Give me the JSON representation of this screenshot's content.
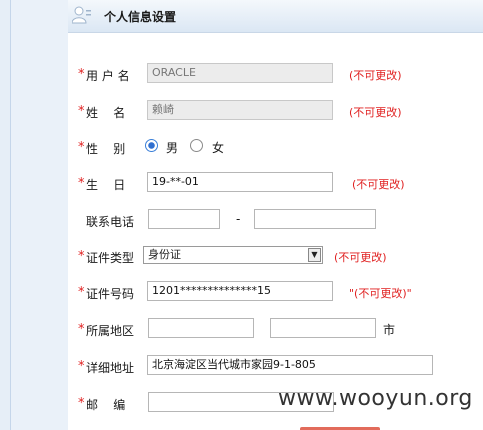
{
  "header": {
    "title": "个人信息设置",
    "icon": "user-icon"
  },
  "form": {
    "username": {
      "star": "*",
      "label": "用 户 名",
      "value": "ORACLE",
      "note": "(不可更改)"
    },
    "name": {
      "star": "*",
      "label": "姓    名",
      "value": "赖崎",
      "note": "(不可更改)"
    },
    "gender": {
      "star": "*",
      "label": "性    别",
      "options": [
        "男",
        "女"
      ],
      "selected": "男"
    },
    "birthday": {
      "star": "*",
      "label": "生    日",
      "value": "19-**-01",
      "note": "(不可更改)"
    },
    "phone": {
      "label": "联系电话",
      "separator": "-",
      "area_value": "",
      "number_value": ""
    },
    "id_type": {
      "star": "*",
      "label": "证件类型",
      "value": "身份证",
      "note": "(不可更改)"
    },
    "id_number": {
      "star": "*",
      "label": "证件号码",
      "value": "1201**************15",
      "note": "\"(不可更改)\""
    },
    "region": {
      "star": "*",
      "label": "所属地区",
      "province_value": "",
      "city_value": "",
      "city_suffix": "市"
    },
    "address": {
      "star": "*",
      "label": "详细地址",
      "value": "北京海淀区当代城市家园9-1-805"
    },
    "postcode": {
      "star": "*",
      "label": "邮    编",
      "value": ""
    }
  },
  "watermark": "www.wooyun.org",
  "colors": {
    "required": "#e02020",
    "header_bg": "#dbe7f4",
    "page_bg": "#eaf1f9"
  }
}
